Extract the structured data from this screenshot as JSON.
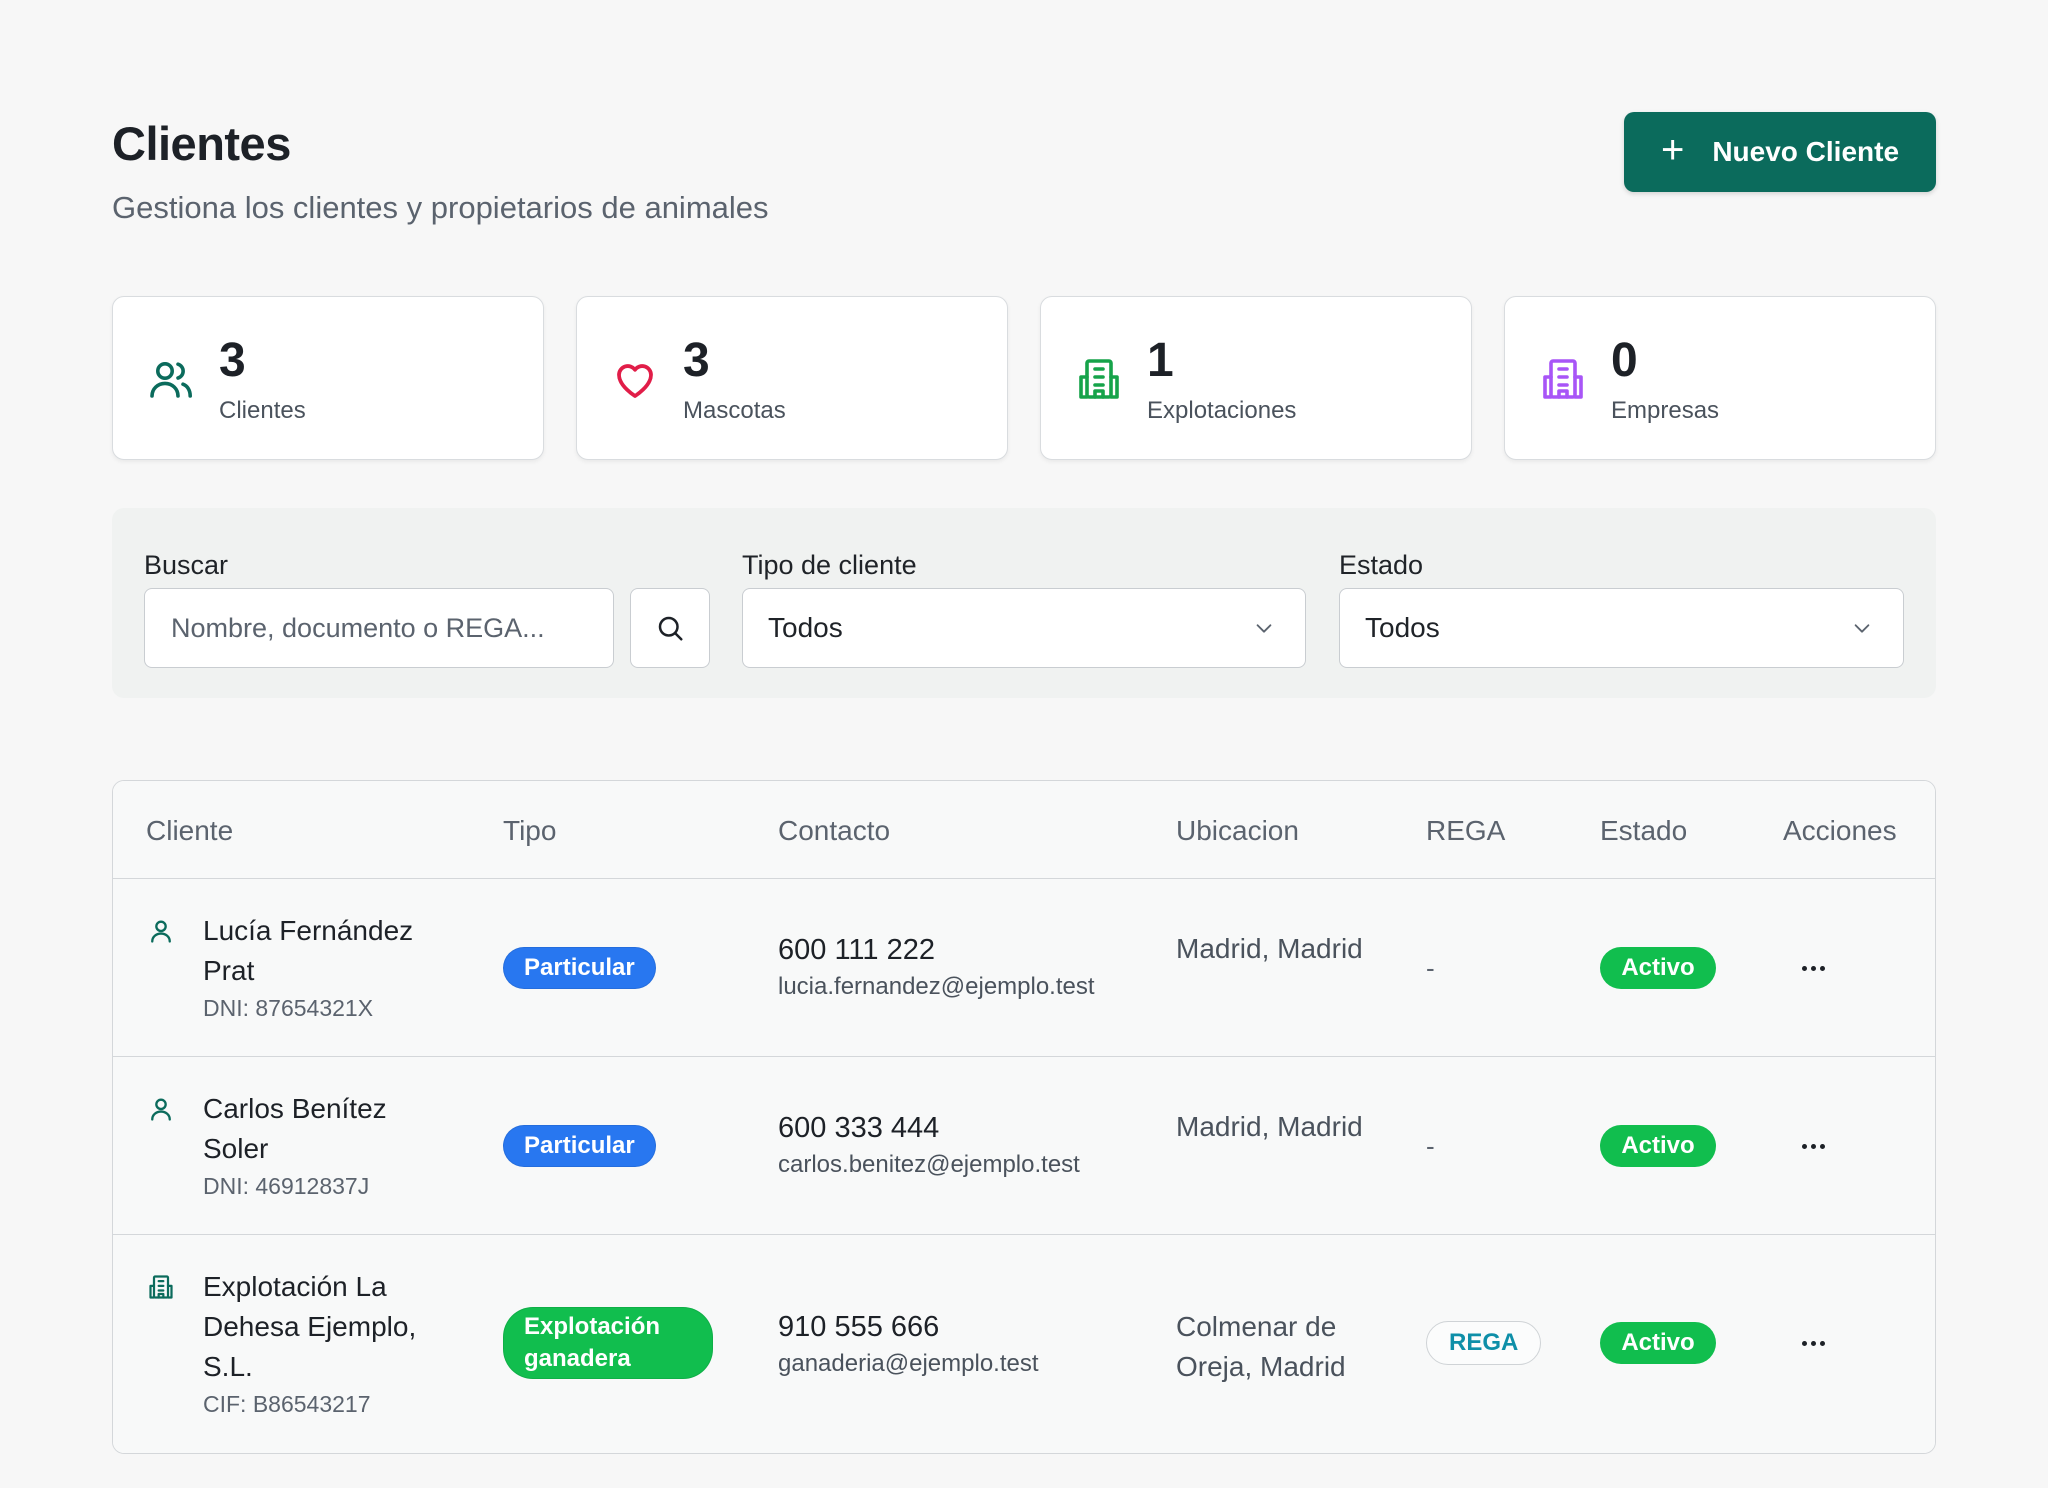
{
  "header": {
    "title": "Clientes",
    "subtitle": "Gestiona los clientes y propietarios de animales",
    "new_button_label": "Nuevo Cliente"
  },
  "stats": [
    {
      "value": "3",
      "label": "Clientes",
      "icon": "users-icon",
      "color": "#0b6b5c"
    },
    {
      "value": "3",
      "label": "Mascotas",
      "icon": "heart-icon",
      "color": "#e11d48"
    },
    {
      "value": "1",
      "label": "Explotaciones",
      "icon": "building-icon",
      "color": "#16a34a"
    },
    {
      "value": "0",
      "label": "Empresas",
      "icon": "building-icon",
      "color": "#a855f7"
    }
  ],
  "filters": {
    "search_label": "Buscar",
    "search_placeholder": "Nombre, documento o REGA...",
    "type_label": "Tipo de cliente",
    "type_value": "Todos",
    "status_label": "Estado",
    "status_value": "Todos"
  },
  "table": {
    "columns": [
      "Cliente",
      "Tipo",
      "Contacto",
      "Ubicacion",
      "REGA",
      "Estado",
      "Acciones"
    ],
    "rows": [
      {
        "name": "Lucía Fernández Prat",
        "doc": "DNI: 87654321X",
        "type": "Particular",
        "phone": "600 111 222",
        "email": "lucia.fernandez@ejemplo.test",
        "location": "Madrid, Madrid",
        "rega": "-",
        "status": "Activo"
      },
      {
        "name": "Carlos Benítez Soler",
        "doc": "DNI: 46912837J",
        "type": "Particular",
        "phone": "600 333 444",
        "email": "carlos.benitez@ejemplo.test",
        "location": "Madrid, Madrid",
        "rega": "-",
        "status": "Activo"
      },
      {
        "name": "Explotación La Dehesa Ejemplo, S.L.",
        "doc": "CIF: B86543217",
        "type": "Explotación ganadera",
        "phone": "910 555 666",
        "email": "ganaderia@ejemplo.test",
        "location": "Colmenar de Oreja, Madrid",
        "rega": "REGA",
        "status": "Activo"
      }
    ]
  },
  "colors": {
    "primary": "#0b6b5c",
    "particular_badge": "#2877f0",
    "active_badge": "#11be4e",
    "rega_text": "#0e8fa8"
  }
}
